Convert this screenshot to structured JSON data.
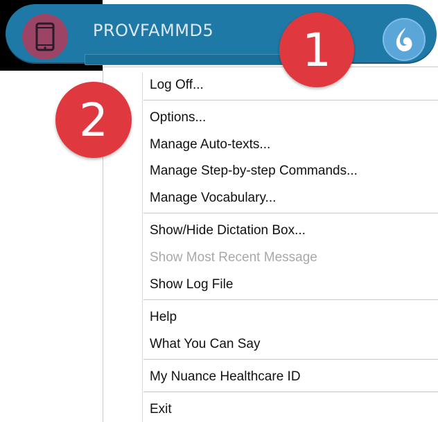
{
  "toolbar": {
    "user_name": "PROVFAMMD5",
    "device_icon": "smartphone-icon",
    "app_icon": "dragon-flame-icon",
    "colors": {
      "bar": "#1f79a6",
      "device_button": "#9b4465",
      "app_button": "#5aa6d8"
    }
  },
  "callouts": {
    "one": "1",
    "two": "2",
    "color": "#e0383f"
  },
  "menu": {
    "items": [
      {
        "label": "Log Off...",
        "enabled": true
      },
      {
        "label": "Options...",
        "enabled": true
      },
      {
        "label": "Manage Auto-texts...",
        "enabled": true
      },
      {
        "label": "Manage Step-by-step Commands...",
        "enabled": true
      },
      {
        "label": "Manage Vocabulary...",
        "enabled": true
      },
      {
        "label": "Show/Hide Dictation Box...",
        "enabled": true
      },
      {
        "label": "Show Most Recent Message",
        "enabled": false
      },
      {
        "label": "Show Log File",
        "enabled": true
      },
      {
        "label": "Help",
        "enabled": true
      },
      {
        "label": "What You Can Say",
        "enabled": true
      },
      {
        "label": "My Nuance Healthcare ID",
        "enabled": true
      },
      {
        "label": "Exit",
        "enabled": true
      }
    ]
  }
}
